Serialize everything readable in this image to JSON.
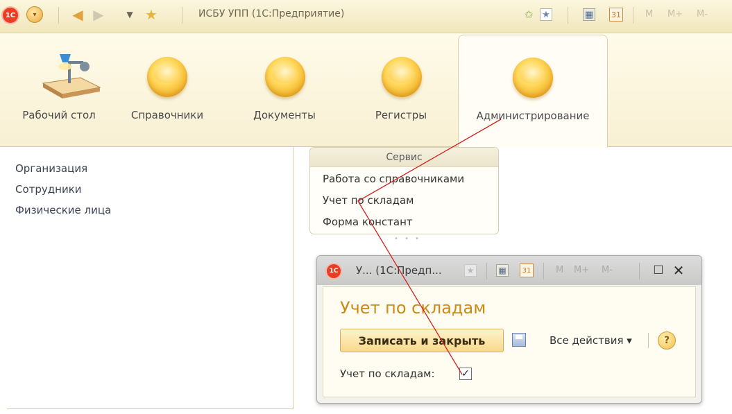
{
  "titlebar": {
    "app_title": "ИСБУ УПП  (1С:Предприятие)",
    "logo_text": "1С",
    "mem_buttons": [
      "M",
      "M+",
      "M-"
    ]
  },
  "sections": [
    {
      "label": "Рабочий стол",
      "icon": "desk-lamp-icon"
    },
    {
      "label": "Справочники",
      "icon": "gold-circle-icon"
    },
    {
      "label": "Документы",
      "icon": "gold-circle-icon"
    },
    {
      "label": "Регистры",
      "icon": "gold-circle-icon"
    },
    {
      "label": "Администрирование",
      "icon": "gold-circle-icon",
      "active": true
    }
  ],
  "left_nav": [
    "Организация",
    "Сотрудники",
    "Физические лица"
  ],
  "service_group": {
    "title": "Сервис",
    "items": [
      "Работа со справочниками",
      "Учет по складам",
      "Форма констант"
    ]
  },
  "window": {
    "title": "У... (1С:Предп...",
    "logo_text": "1С",
    "mem_buttons": [
      "M",
      "M+",
      "M-"
    ],
    "form_title": "Учет по складам",
    "save_close_label": "Записать и закрыть",
    "all_actions_label": "Все действия ▾",
    "help_label": "?",
    "checkbox_label": "Учет по складам:",
    "checkbox_checked": true
  },
  "colors": {
    "accent": "#cb8a16",
    "annotation_line": "#d12020"
  }
}
